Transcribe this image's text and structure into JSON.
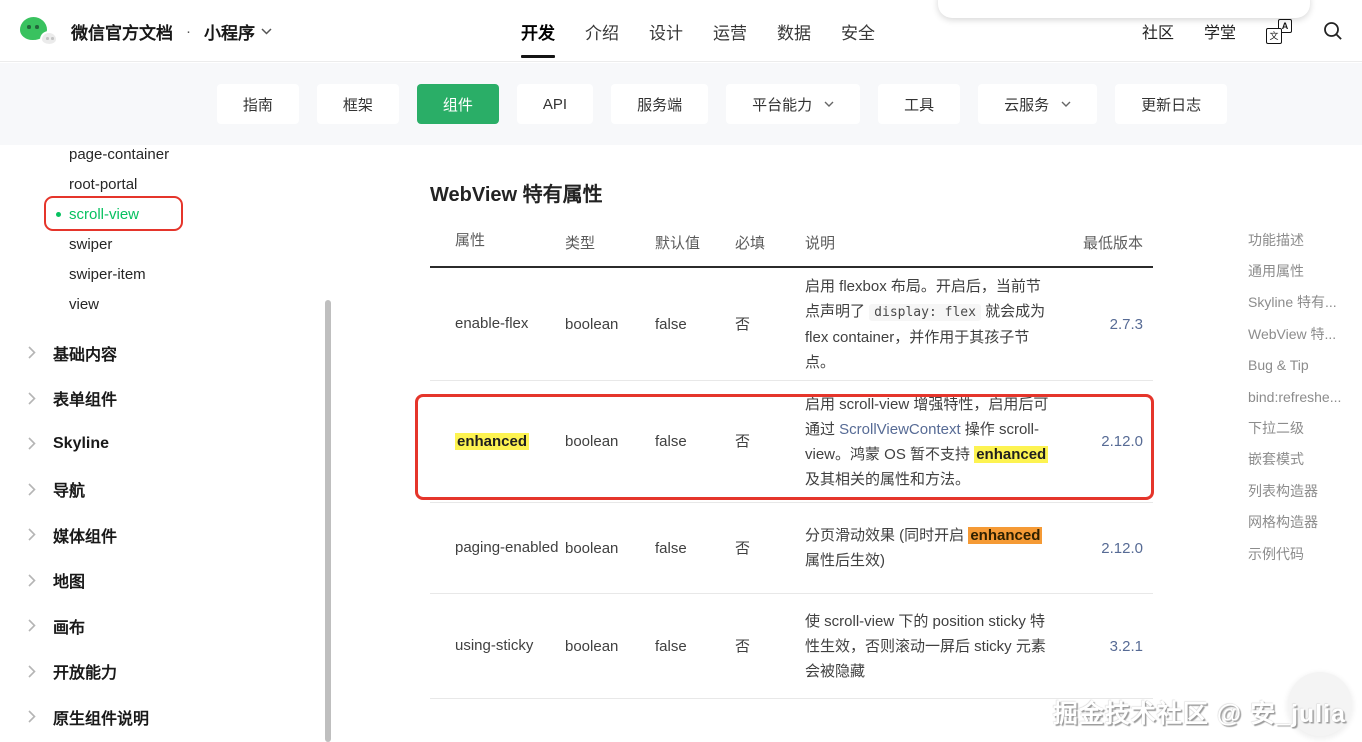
{
  "colors": {
    "accent_green": "#2aae67",
    "sidebar_active_green": "#07c160",
    "link_blue": "#576b95",
    "annotation_red": "#e5352b",
    "highlight_yellow": "#fdf351",
    "highlight_orange": "#f59a35"
  },
  "header": {
    "brand_title": "微信官方文档",
    "brand_dot": "·",
    "brand_product": "小程序",
    "nav": [
      {
        "label": "开发",
        "active": true
      },
      {
        "label": "介绍",
        "active": false
      },
      {
        "label": "设计",
        "active": false
      },
      {
        "label": "运营",
        "active": false
      },
      {
        "label": "数据",
        "active": false
      },
      {
        "label": "安全",
        "active": false
      }
    ],
    "links": [
      {
        "label": "社区"
      },
      {
        "label": "学堂"
      }
    ],
    "translate_icon": {
      "zh": "文",
      "en": "A"
    }
  },
  "subnav": {
    "items": [
      {
        "label": "指南",
        "active": false,
        "dropdown": false
      },
      {
        "label": "框架",
        "active": false,
        "dropdown": false
      },
      {
        "label": "组件",
        "active": true,
        "dropdown": false
      },
      {
        "label": "API",
        "active": false,
        "dropdown": false
      },
      {
        "label": "服务端",
        "active": false,
        "dropdown": false
      },
      {
        "label": "平台能力",
        "active": false,
        "dropdown": true
      },
      {
        "label": "工具",
        "active": false,
        "dropdown": false
      },
      {
        "label": "云服务",
        "active": false,
        "dropdown": true
      },
      {
        "label": "更新日志",
        "active": false,
        "dropdown": false
      }
    ]
  },
  "sidebar": {
    "components": [
      {
        "label": "page-container",
        "active": false
      },
      {
        "label": "root-portal",
        "active": false
      },
      {
        "label": "scroll-view",
        "active": true,
        "annotated": true
      },
      {
        "label": "swiper",
        "active": false
      },
      {
        "label": "swiper-item",
        "active": false
      },
      {
        "label": "view",
        "active": false
      }
    ],
    "sections": [
      {
        "label": "基础内容"
      },
      {
        "label": "表单组件"
      },
      {
        "label": "Skyline"
      },
      {
        "label": "导航"
      },
      {
        "label": "媒体组件"
      },
      {
        "label": "地图"
      },
      {
        "label": "画布"
      },
      {
        "label": "开放能力"
      },
      {
        "label": "原生组件说明"
      }
    ]
  },
  "content": {
    "heading": "WebView 特有属性",
    "table": {
      "columns": [
        "属性",
        "类型",
        "默认值",
        "必填",
        "说明",
        "最低版本"
      ],
      "rows": [
        {
          "property": "enable-flex",
          "type": "boolean",
          "default": "false",
          "required": "否",
          "min_version": "2.7.3",
          "desc": [
            "启用 flexbox 布局。开启后，当前节点声明了 ",
            "display: flex",
            " 就会成为 flex container，并作用于其孩子节点。"
          ]
        },
        {
          "property": "enhanced",
          "type": "boolean",
          "default": "false",
          "required": "否",
          "min_version": "2.12.0",
          "desc": [
            "启用 scroll-view 增强特性，启用后可通过 ",
            "ScrollViewContext",
            " 操作 scroll-view。鸿蒙 OS 暂不支持 ",
            "enhanced",
            " 及其相关的属性和方法。"
          ]
        },
        {
          "property": "paging-enabled",
          "type": "boolean",
          "default": "false",
          "required": "否",
          "min_version": "2.12.0",
          "desc": [
            "分页滑动效果 (同时开启 ",
            "enhanced",
            " 属性后生效)"
          ]
        },
        {
          "property": "using-sticky",
          "type": "boolean",
          "default": "false",
          "required": "否",
          "min_version": "3.2.1",
          "desc": [
            "使 scroll-view 下的 position sticky 特性生效，否则滚动一屏后 sticky 元素会被隐藏"
          ]
        }
      ]
    }
  },
  "toc": {
    "items": [
      {
        "label": "功能描述"
      },
      {
        "label": "通用属性"
      },
      {
        "label": "Skyline 特有..."
      },
      {
        "label": "WebView 特..."
      },
      {
        "label": "Bug & Tip"
      },
      {
        "label": "bind:refreshe..."
      },
      {
        "label": "下拉二级"
      },
      {
        "label": "嵌套模式"
      },
      {
        "label": "列表构造器"
      },
      {
        "label": "网格构造器"
      },
      {
        "label": "示例代码"
      }
    ]
  },
  "watermark": {
    "text": "掘金技术社区 @ 安_julia"
  }
}
